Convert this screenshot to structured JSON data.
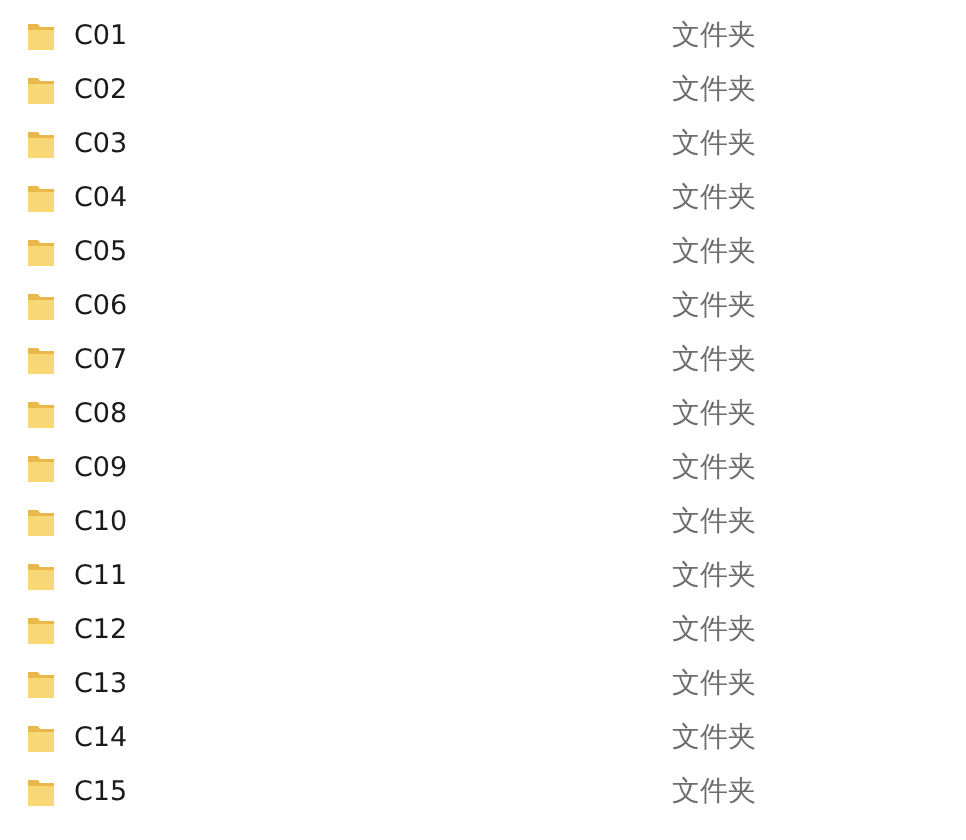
{
  "files": [
    {
      "name": "C01",
      "type": "文件夹"
    },
    {
      "name": "C02",
      "type": "文件夹"
    },
    {
      "name": "C03",
      "type": "文件夹"
    },
    {
      "name": "C04",
      "type": "文件夹"
    },
    {
      "name": "C05",
      "type": "文件夹"
    },
    {
      "name": "C06",
      "type": "文件夹"
    },
    {
      "name": "C07",
      "type": "文件夹"
    },
    {
      "name": "C08",
      "type": "文件夹"
    },
    {
      "name": "C09",
      "type": "文件夹"
    },
    {
      "name": "C10",
      "type": "文件夹"
    },
    {
      "name": "C11",
      "type": "文件夹"
    },
    {
      "name": "C12",
      "type": "文件夹"
    },
    {
      "name": "C13",
      "type": "文件夹"
    },
    {
      "name": "C14",
      "type": "文件夹"
    },
    {
      "name": "C15",
      "type": "文件夹"
    }
  ]
}
